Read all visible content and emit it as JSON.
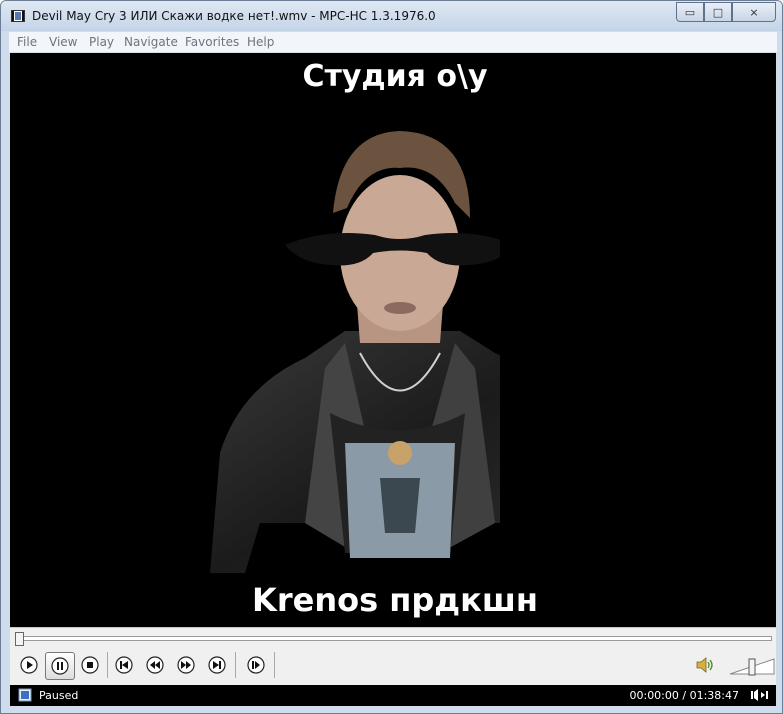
{
  "window": {
    "title": "Devil May Cry 3 ИЛИ Скажи водке нет!.wmv - MPC-HC 1.3.1976.0",
    "buttons": {
      "minimize": "▭",
      "maximize": "□",
      "close": "⨯"
    }
  },
  "menu": {
    "items": [
      {
        "label": "File"
      },
      {
        "label": "View"
      },
      {
        "label": "Play"
      },
      {
        "label": "Navigate"
      },
      {
        "label": "Favorites"
      },
      {
        "label": "Help"
      }
    ]
  },
  "video": {
    "top_text": "Студия о\\у",
    "bottom_text": "Krenos прдкшн"
  },
  "seek": {
    "position": 0.0
  },
  "status": {
    "state": "Paused",
    "time": "00:00:00 / 01:38:47"
  },
  "icons": {
    "play": "play-icon",
    "pause": "pause-icon",
    "stop": "stop-icon",
    "prev": "skip-previous-icon",
    "rewind": "rewind-icon",
    "forward": "fast-forward-icon",
    "next": "skip-next-icon",
    "frame_step": "frame-step-icon",
    "volume": "speaker-icon"
  },
  "colors": {
    "frame": "#cfdcec",
    "video_bg": "#000000",
    "status_bg": "#000000"
  }
}
